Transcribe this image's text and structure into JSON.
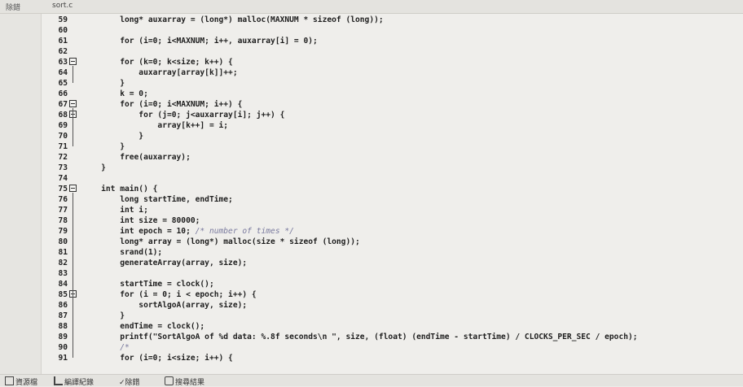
{
  "header": {
    "side_label": "除錯",
    "file_tab": "sort.c"
  },
  "lines": [
    {
      "n": "59",
      "code": "        long* auxarray = (long*) malloc(MAXNUM * sizeof (long));",
      "fold": false
    },
    {
      "n": "60",
      "code": "",
      "fold": false
    },
    {
      "n": "61",
      "code": "        for (i=0; i<MAXNUM; i++, auxarray[i] = 0);",
      "fold": false
    },
    {
      "n": "62",
      "code": "",
      "fold": false
    },
    {
      "n": "63",
      "code": "        for (k=0; k<size; k++) {",
      "fold": true
    },
    {
      "n": "64",
      "code": "            auxarray[array[k]]++;",
      "fold": false
    },
    {
      "n": "65",
      "code": "        }",
      "fold": false
    },
    {
      "n": "66",
      "code": "        k = 0;",
      "fold": false
    },
    {
      "n": "67",
      "code": "        for (i=0; i<MAXNUM; i++) {",
      "fold": true
    },
    {
      "n": "68",
      "code": "            for (j=0; j<auxarray[i]; j++) {",
      "fold": true
    },
    {
      "n": "69",
      "code": "                array[k++] = i;",
      "fold": false
    },
    {
      "n": "70",
      "code": "            }",
      "fold": false
    },
    {
      "n": "71",
      "code": "        }",
      "fold": false
    },
    {
      "n": "72",
      "code": "        free(auxarray);",
      "fold": false
    },
    {
      "n": "73",
      "code": "    }",
      "fold": false
    },
    {
      "n": "74",
      "code": "",
      "fold": false
    },
    {
      "n": "75",
      "code": "    int main() {",
      "fold": true
    },
    {
      "n": "76",
      "code": "        long startTime, endTime;",
      "fold": false
    },
    {
      "n": "77",
      "code": "        int i;",
      "fold": false
    },
    {
      "n": "78",
      "code": "        int size = 80000;",
      "fold": false
    },
    {
      "n": "79",
      "code": "        int epoch = 10; /* number of times */",
      "fold": false
    },
    {
      "n": "80",
      "code": "        long* array = (long*) malloc(size * sizeof (long));",
      "fold": false
    },
    {
      "n": "81",
      "code": "        srand(1);",
      "fold": false
    },
    {
      "n": "82",
      "code": "        generateArray(array, size);",
      "fold": false
    },
    {
      "n": "83",
      "code": "",
      "fold": false
    },
    {
      "n": "84",
      "code": "        startTime = clock();",
      "fold": false
    },
    {
      "n": "85",
      "code": "        for (i = 0; i < epoch; i++) {",
      "fold": true
    },
    {
      "n": "86",
      "code": "            sortAlgoA(array, size);",
      "fold": false
    },
    {
      "n": "87",
      "code": "        }",
      "fold": false
    },
    {
      "n": "88",
      "code": "        endTime = clock();",
      "fold": false
    },
    {
      "n": "89",
      "code": "        printf(\"SortAlgoA of %d data: %.8f seconds\\n \", size, (float) (endTime - startTime) / CLOCKS_PER_SEC / epoch);",
      "fold": false
    },
    {
      "n": "90",
      "code": "        /*",
      "fold": false
    },
    {
      "n": "91",
      "code": "        for (i=0; i<size; i++) {",
      "fold": false
    }
  ],
  "bottom_tabs": [
    {
      "label": "資源檔",
      "icon": "resources-icon"
    },
    {
      "label": "編譯紀錄",
      "icon": "compile-log-icon"
    },
    {
      "label": "除錯",
      "icon": "debug-check-icon"
    },
    {
      "label": "搜尋結果",
      "icon": "search-results-icon"
    }
  ],
  "colors": {
    "background": "#efeeeb",
    "text": "#1e1e1e",
    "comment": "#7a7a9e"
  }
}
